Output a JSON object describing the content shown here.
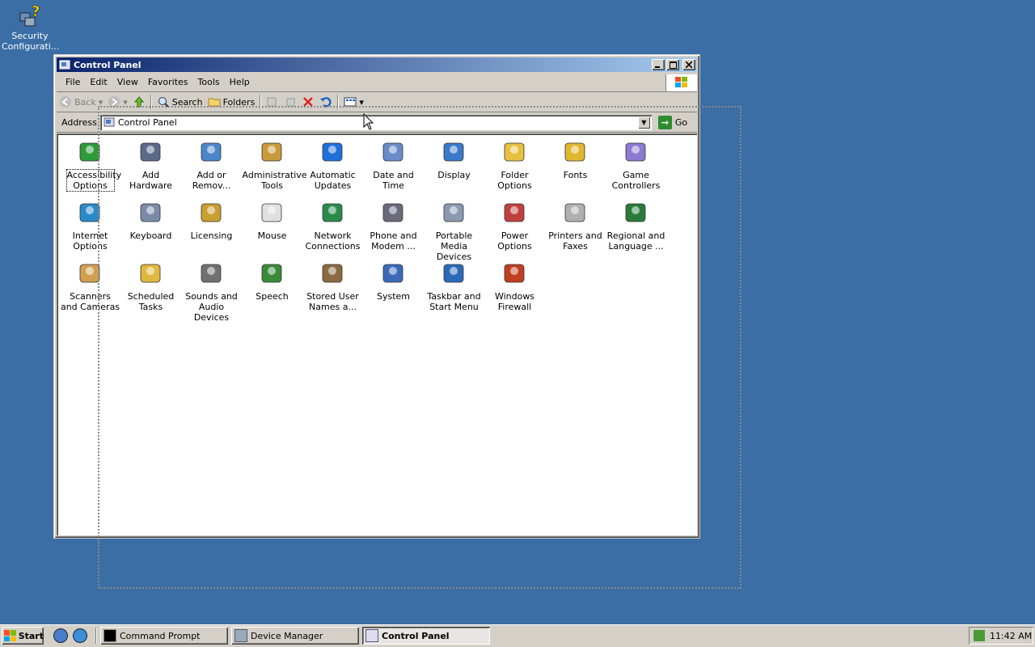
{
  "desktop": {
    "icons": [
      {
        "label": "Security Configurati...",
        "icon": "security-config-icon"
      }
    ]
  },
  "window": {
    "title": "Control Panel",
    "menu": [
      "File",
      "Edit",
      "View",
      "Favorites",
      "Tools",
      "Help"
    ],
    "toolbar": {
      "back": "Back",
      "search": "Search",
      "folders": "Folders"
    },
    "address": {
      "label": "Address",
      "value": "Control Panel",
      "go": "Go"
    },
    "items": [
      {
        "label": "Accessibility Options",
        "icon": "accessibility-icon"
      },
      {
        "label": "Add Hardware",
        "icon": "add-hardware-icon"
      },
      {
        "label": "Add or Remov...",
        "icon": "add-remove-programs-icon"
      },
      {
        "label": "Administrative Tools",
        "icon": "administrative-tools-icon"
      },
      {
        "label": "Automatic Updates",
        "icon": "automatic-updates-icon"
      },
      {
        "label": "Date and Time",
        "icon": "date-time-icon"
      },
      {
        "label": "Display",
        "icon": "display-icon"
      },
      {
        "label": "Folder Options",
        "icon": "folder-options-icon"
      },
      {
        "label": "Fonts",
        "icon": "fonts-icon"
      },
      {
        "label": "Game Controllers",
        "icon": "game-controllers-icon"
      },
      {
        "label": "Internet Options",
        "icon": "internet-options-icon"
      },
      {
        "label": "Keyboard",
        "icon": "keyboard-icon"
      },
      {
        "label": "Licensing",
        "icon": "licensing-icon"
      },
      {
        "label": "Mouse",
        "icon": "mouse-icon"
      },
      {
        "label": "Network Connections",
        "icon": "network-connections-icon"
      },
      {
        "label": "Phone and Modem ...",
        "icon": "phone-modem-icon"
      },
      {
        "label": "Portable Media Devices",
        "icon": "portable-media-icon"
      },
      {
        "label": "Power Options",
        "icon": "power-options-icon"
      },
      {
        "label": "Printers and Faxes",
        "icon": "printers-faxes-icon"
      },
      {
        "label": "Regional and Language ...",
        "icon": "regional-language-icon"
      },
      {
        "label": "Scanners and Cameras",
        "icon": "scanners-cameras-icon"
      },
      {
        "label": "Scheduled Tasks",
        "icon": "scheduled-tasks-icon"
      },
      {
        "label": "Sounds and Audio Devices",
        "icon": "sounds-audio-icon"
      },
      {
        "label": "Speech",
        "icon": "speech-icon"
      },
      {
        "label": "Stored User Names a...",
        "icon": "stored-user-names-icon"
      },
      {
        "label": "System",
        "icon": "system-icon"
      },
      {
        "label": "Taskbar and Start Menu",
        "icon": "taskbar-start-menu-icon"
      },
      {
        "label": "Windows Firewall",
        "icon": "windows-firewall-icon"
      }
    ]
  },
  "taskbar": {
    "start": "Start",
    "tasks": [
      {
        "label": "Command Prompt",
        "icon": "command-prompt-icon"
      },
      {
        "label": "Device Manager",
        "icon": "device-manager-icon"
      },
      {
        "label": "Control Panel",
        "icon": "control-panel-icon"
      }
    ],
    "clock": "11:42 AM"
  },
  "colors": {
    "desktop": "#3a6ea5",
    "title_active": "#0a246a",
    "title_gradient_end": "#a6caf0"
  }
}
